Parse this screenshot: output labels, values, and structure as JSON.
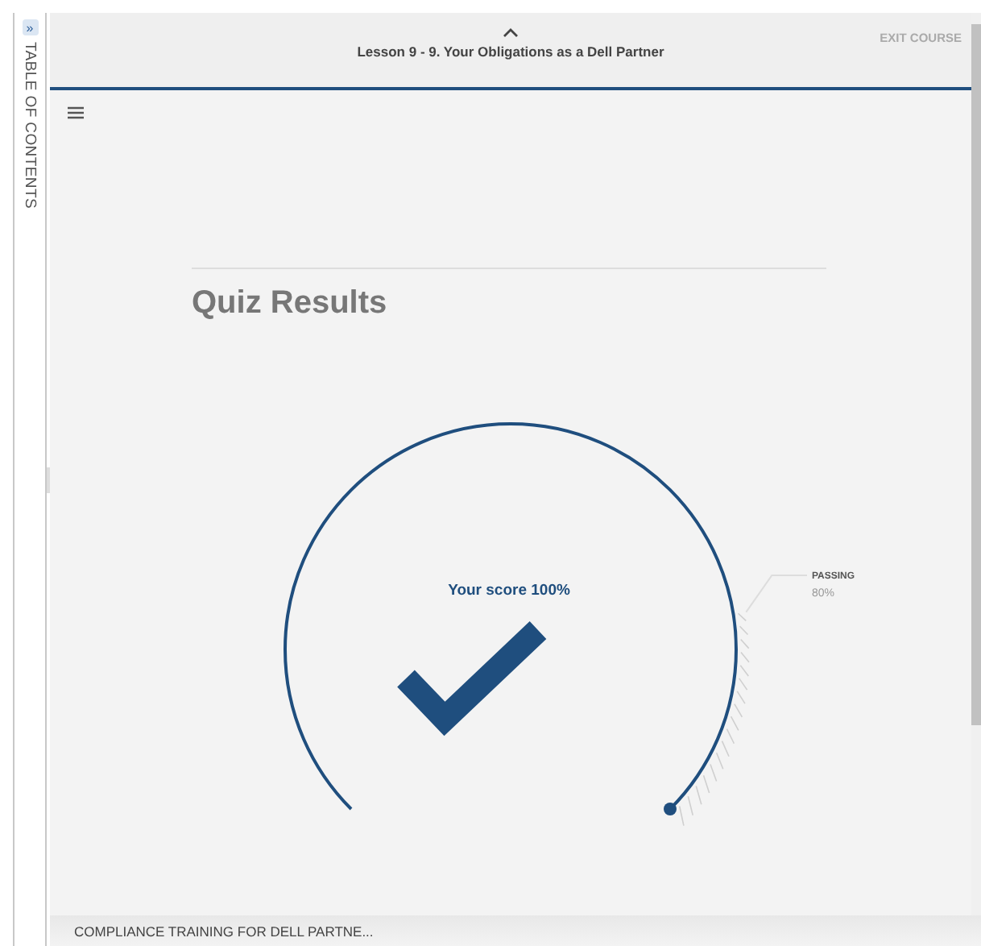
{
  "sidebar": {
    "toggle": "»",
    "label": "TABLE OF CONTENTS"
  },
  "header": {
    "lesson_title": "Lesson 9 - 9. Your Obligations as a Dell Partner",
    "exit": "EXIT COURSE"
  },
  "quiz": {
    "title": "Quiz Results",
    "score": {
      "label": "Your score 100%",
      "level": 1
    },
    "passing": {
      "label": "PASSING",
      "value": "80%",
      "level": 0.8
    }
  },
  "footer": {
    "course_title": "COMPLIANCE TRAINING FOR DELL PARTNE..."
  }
}
